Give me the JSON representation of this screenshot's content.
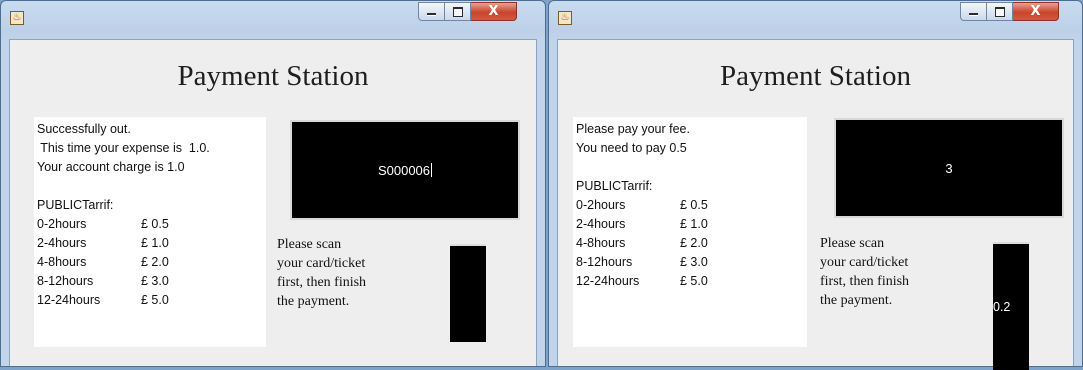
{
  "windows": [
    {
      "title": "Payment Station",
      "close_label": "X",
      "messages": [
        "Successfully out.",
        " This time your expense is  1.0.",
        "Your account charge is 1.0"
      ],
      "tariff_heading": "PUBLICTarrif:",
      "tariffs": [
        {
          "period": "0-2hours",
          "price": "£ 0.5"
        },
        {
          "period": "2-4hours",
          "price": "£ 1.0"
        },
        {
          "period": "4-8hours",
          "price": "£ 2.0"
        },
        {
          "period": "8-12hours",
          "price": "£ 3.0"
        },
        {
          "period": "12-24hours",
          "price": "£ 5.0"
        }
      ],
      "display_text": "S000006",
      "instructions": [
        "Please scan",
        "your card/ticket",
        "first, then finish",
        "the payment."
      ],
      "small_display_text": ""
    },
    {
      "title": "Payment Station",
      "close_label": "X",
      "messages": [
        "Please pay your fee.",
        "You need to pay 0.5"
      ],
      "tariff_heading": "PUBLICTarrif:",
      "tariffs": [
        {
          "period": "0-2hours",
          "price": "£ 0.5"
        },
        {
          "period": "2-4hours",
          "price": "£ 1.0"
        },
        {
          "period": "4-8hours",
          "price": "£ 2.0"
        },
        {
          "period": "8-12hours",
          "price": "£ 3.0"
        },
        {
          "period": "12-24hours",
          "price": "£ 5.0"
        }
      ],
      "display_text": "3",
      "instructions": [
        "Please scan",
        "your card/ticket",
        "first, then finish",
        "the payment."
      ],
      "small_display_text": "0.2"
    }
  ],
  "icons": {
    "app": "java-app-icon",
    "minimize": "minimize-icon",
    "maximize": "maximize-icon",
    "close": "close-icon"
  }
}
